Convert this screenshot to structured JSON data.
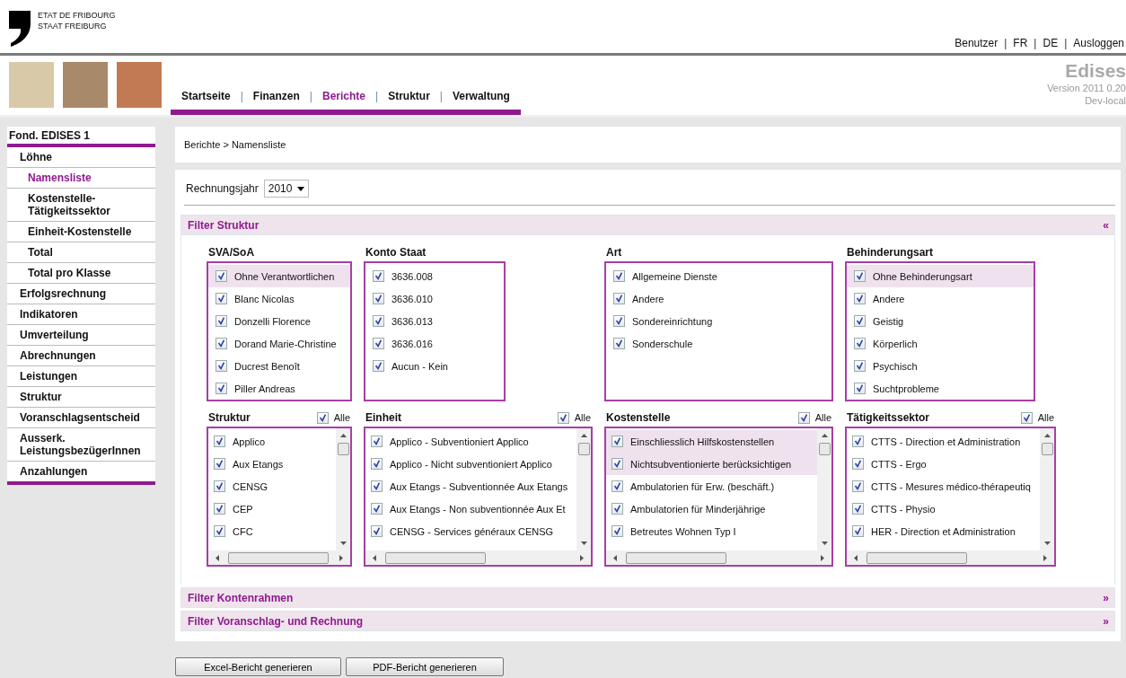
{
  "header": {
    "logo_lines": [
      "ETAT DE FRIBOURG",
      "STAAT FREIBURG"
    ],
    "top_links": [
      "Benutzer",
      "FR",
      "DE",
      "Ausloggen"
    ],
    "separator": "|"
  },
  "nav": {
    "tabs": [
      {
        "label": "Startseite",
        "selected": false
      },
      {
        "label": "Finanzen",
        "selected": false
      },
      {
        "label": "Berichte",
        "selected": true
      },
      {
        "label": "Struktur",
        "selected": false
      },
      {
        "label": "Verwaltung",
        "selected": false
      }
    ]
  },
  "app_info": {
    "title": "Edises",
    "version": "Version 2011 0.20",
    "environment": "Dev-local"
  },
  "sidebar": {
    "title": "Fond. EDISES 1",
    "items": [
      {
        "label": "Löhne",
        "selected": false,
        "children": [
          {
            "label": "Namensliste",
            "selected": true
          },
          {
            "label": "Kostenstelle-Tätigkeitssektor",
            "selected": false
          },
          {
            "label": "Einheit-Kostenstelle",
            "selected": false
          },
          {
            "label": "Total",
            "selected": false
          },
          {
            "label": "Total pro Klasse",
            "selected": false
          }
        ]
      },
      {
        "label": "Erfolgsrechnung",
        "selected": false
      },
      {
        "label": "Indikatoren",
        "selected": false
      },
      {
        "label": "Umverteilung",
        "selected": false
      },
      {
        "label": "Abrechnungen",
        "selected": false
      },
      {
        "label": "Leistungen",
        "selected": false
      },
      {
        "label": "Struktur",
        "selected": false
      },
      {
        "label": "Voranschlagsentscheid",
        "selected": false
      },
      {
        "label": "Ausserk. LeistungsbezügerInnen",
        "selected": false
      },
      {
        "label": "Anzahlungen",
        "selected": false
      }
    ]
  },
  "breadcrumb": "Berichte > Namensliste",
  "year": {
    "label": "Rechnungsjahr",
    "value": "2010"
  },
  "filters": [
    {
      "title": "Filter Struktur",
      "toggle": "«",
      "groups": [
        {
          "title": "SVA/SoA",
          "scrollable": false,
          "items": [
            {
              "label": "Ohne Verantwortlichen",
              "kind": "highlighted",
              "checked": true
            },
            {
              "label": "Blanc Nicolas",
              "kind": "normal",
              "checked": true
            },
            {
              "label": "Donzelli Florence",
              "kind": "normal",
              "checked": true
            },
            {
              "label": "Dorand Marie-Christine",
              "kind": "normal",
              "checked": true
            },
            {
              "label": "Ducrest Benoît",
              "kind": "normal",
              "checked": true
            },
            {
              "label": "Piller Andreas",
              "kind": "normal",
              "checked": true
            }
          ]
        },
        {
          "title": "Konto Staat",
          "scrollable": false,
          "items": [
            {
              "label": "3636.008",
              "kind": "normal",
              "checked": true
            },
            {
              "label": "3636.010",
              "kind": "normal",
              "checked": true
            },
            {
              "label": "3636.013",
              "kind": "normal",
              "checked": true
            },
            {
              "label": "3636.016",
              "kind": "normal",
              "checked": true
            },
            {
              "label": "Aucun - Kein",
              "kind": "normal",
              "checked": true
            }
          ]
        },
        {
          "title": "Art",
          "scrollable": false,
          "items": [
            {
              "label": "Allgemeine Dienste",
              "kind": "normal",
              "checked": true
            },
            {
              "label": "Andere",
              "kind": "normal",
              "checked": true
            },
            {
              "label": "Sondereinrichtung",
              "kind": "normal",
              "checked": true
            },
            {
              "label": "Sonderschule",
              "kind": "normal",
              "checked": true
            }
          ]
        },
        {
          "title": "Behinderungsart",
          "scrollable": false,
          "items": [
            {
              "label": "Ohne Behinderungsart",
              "kind": "highlighted",
              "checked": true
            },
            {
              "label": "Andere",
              "kind": "normal",
              "checked": true
            },
            {
              "label": "Geistig",
              "kind": "normal",
              "checked": true
            },
            {
              "label": "Körperlich",
              "kind": "normal",
              "checked": true
            },
            {
              "label": "Psychisch",
              "kind": "normal",
              "checked": true
            },
            {
              "label": "Suchtprobleme",
              "kind": "normal",
              "checked": true
            }
          ]
        },
        {
          "title": "Struktur",
          "scrollable": true,
          "all": {
            "label": "Alle",
            "checked": true
          },
          "items": [
            {
              "label": "Applico",
              "kind": "normal",
              "checked": true
            },
            {
              "label": "Aux Etangs",
              "kind": "normal",
              "checked": true
            },
            {
              "label": "CENSG",
              "kind": "normal",
              "checked": true
            },
            {
              "label": "CEP",
              "kind": "normal",
              "checked": true
            },
            {
              "label": "CFC",
              "kind": "normal",
              "checked": true
            }
          ]
        },
        {
          "title": "Einheit",
          "scrollable": true,
          "all": {
            "label": "Alle",
            "checked": true
          },
          "items": [
            {
              "label": "Applico - Subventioniert Applico",
              "kind": "normal",
              "checked": true
            },
            {
              "label": "Applico - Nicht subventioniert Applico",
              "kind": "normal",
              "checked": true
            },
            {
              "label": "Aux Etangs - Subventionnée Aux Etangs",
              "kind": "normal",
              "checked": true
            },
            {
              "label": "Aux Etangs - Non subventionnée Aux Et",
              "kind": "normal",
              "checked": true
            },
            {
              "label": "CENSG - Services généraux CENSG",
              "kind": "normal",
              "checked": true
            }
          ]
        },
        {
          "title": "Kostenstelle",
          "scrollable": true,
          "all": {
            "label": "Alle",
            "checked": true
          },
          "items": [
            {
              "label": "Einschliesslich Hilfskostenstellen",
              "kind": "highlighted",
              "checked": true
            },
            {
              "label": "Nichtsubventionierte berücksichtigen",
              "kind": "highlighted",
              "checked": true
            },
            {
              "label": "Ambulatorien für Erw. (beschäft.)",
              "kind": "normal",
              "checked": true
            },
            {
              "label": "Ambulatorien für Minderjährige",
              "kind": "normal",
              "checked": true
            },
            {
              "label": "Betreutes Wohnen Typ I",
              "kind": "normal",
              "checked": true
            }
          ]
        },
        {
          "title": "Tätigkeitssektor",
          "scrollable": true,
          "all": {
            "label": "Alle",
            "checked": true
          },
          "items": [
            {
              "label": "CTTS - Direction et Administration",
              "kind": "normal",
              "checked": true
            },
            {
              "label": "CTTS - Ergo",
              "kind": "normal",
              "checked": true
            },
            {
              "label": "CTTS - Mesures médico-thérapeutiq",
              "kind": "normal",
              "checked": true
            },
            {
              "label": "CTTS - Physio",
              "kind": "normal",
              "checked": true
            },
            {
              "label": "HER - Direction et Administration",
              "kind": "normal",
              "checked": true
            }
          ]
        }
      ]
    },
    {
      "title": "Filter Kontenrahmen",
      "toggle": "»"
    },
    {
      "title": "Filter Voranschlag- und Rechnung",
      "toggle": "»"
    }
  ],
  "buttons": [
    "Excel-Bericht generieren",
    "PDF-Bericht generieren"
  ]
}
